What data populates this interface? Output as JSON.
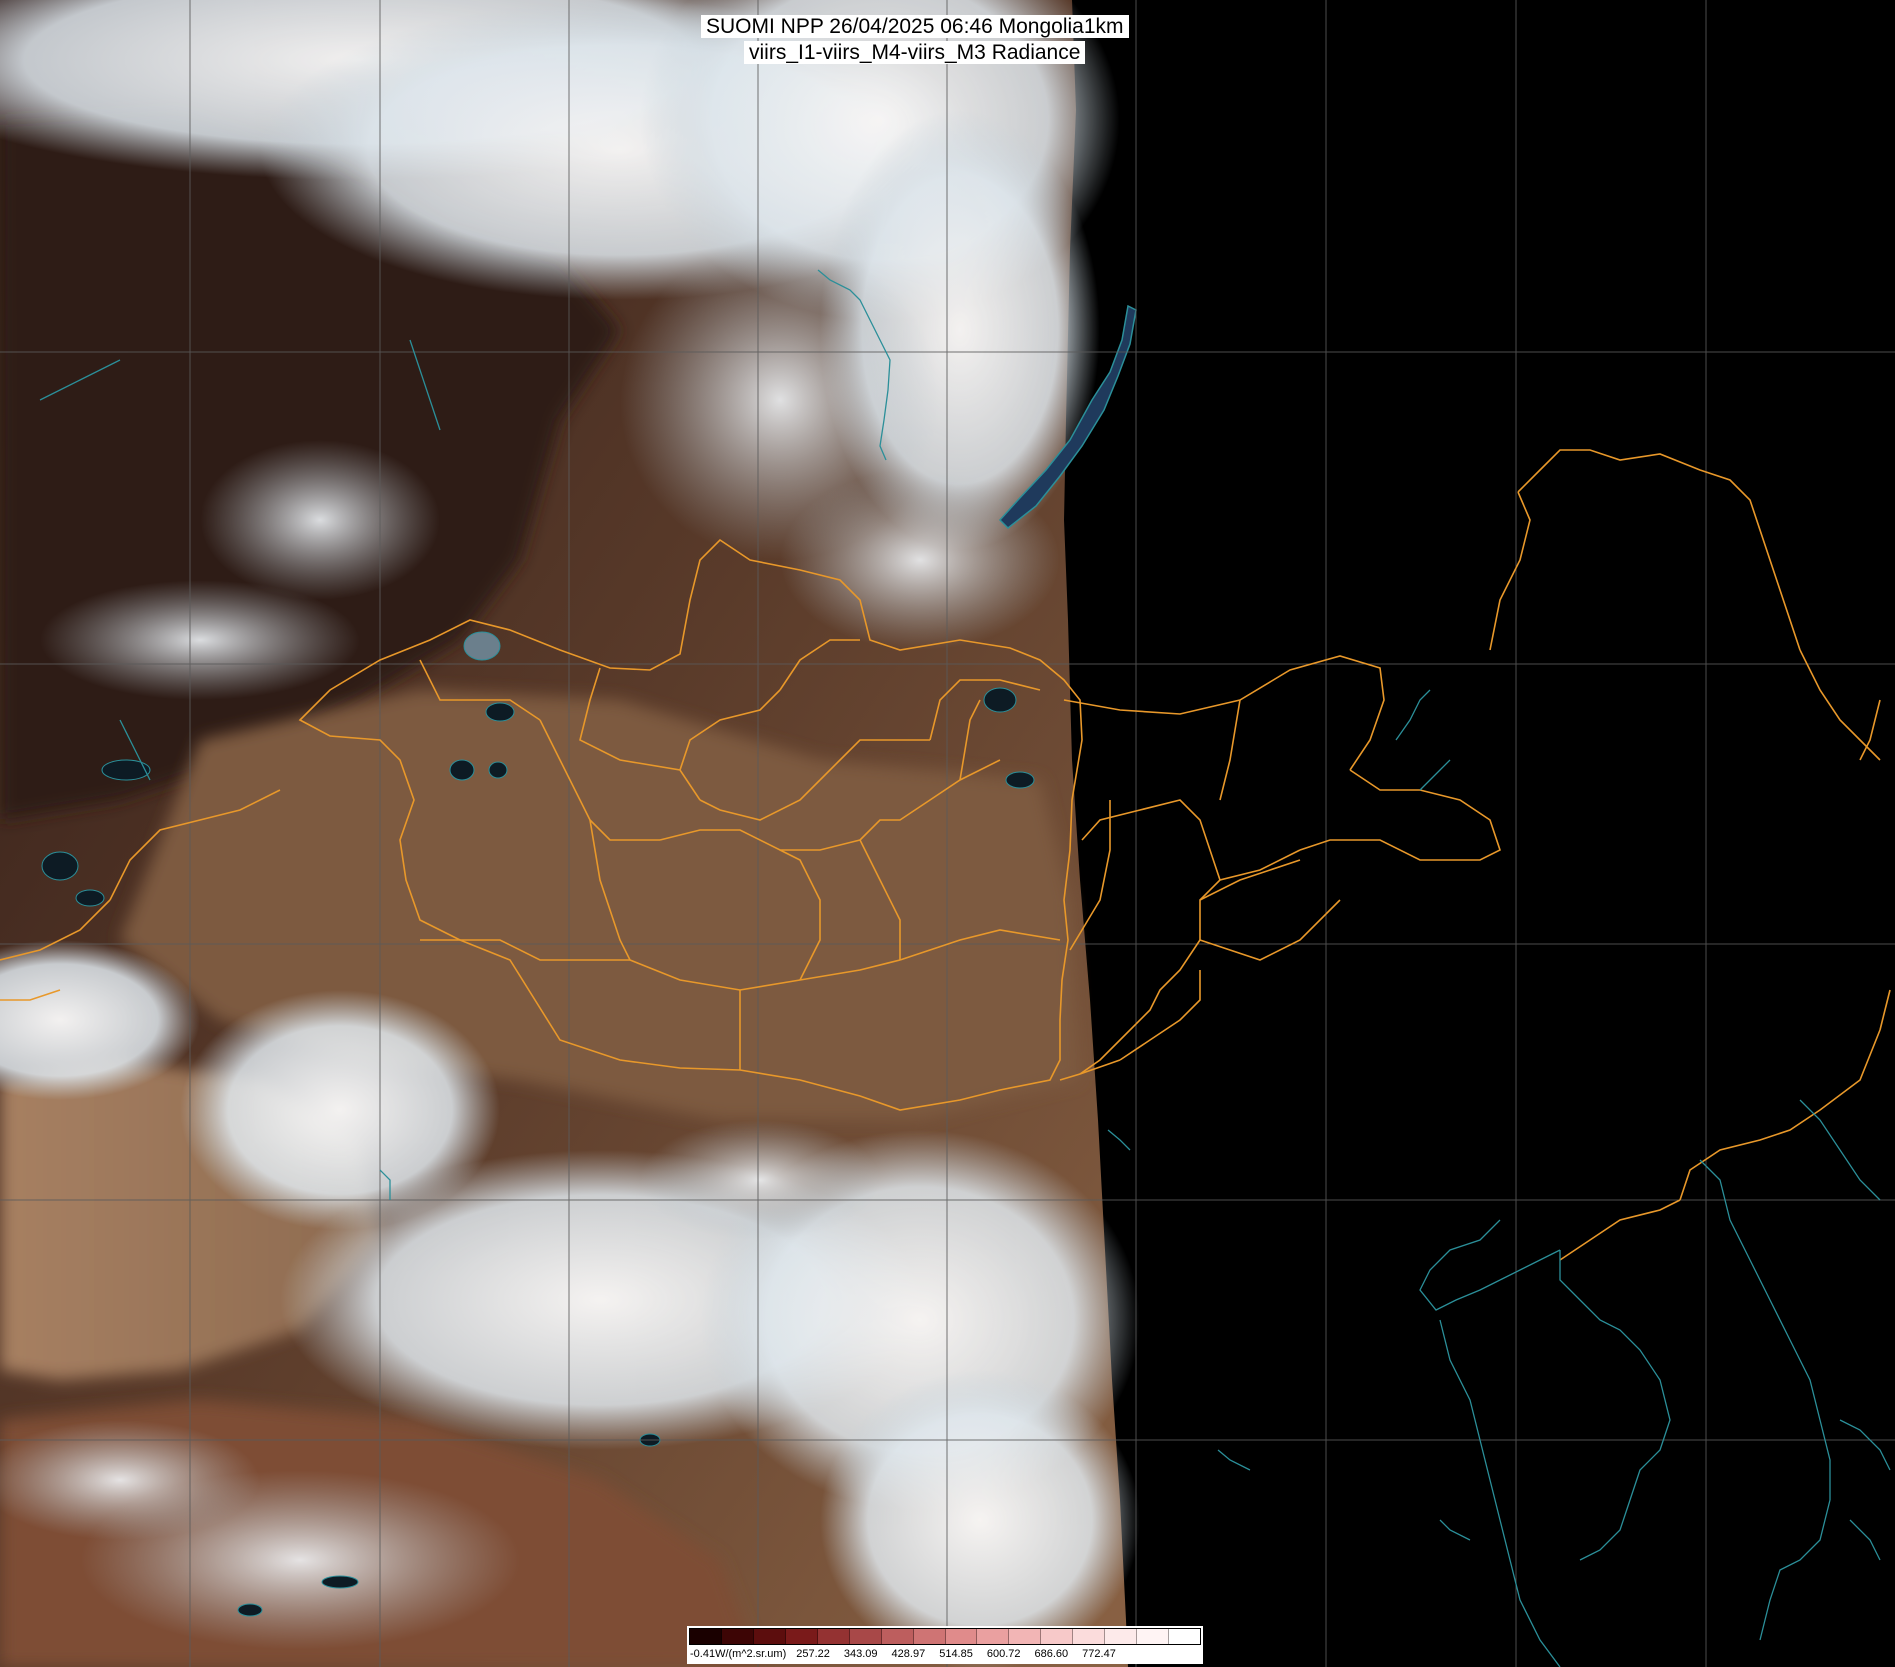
{
  "title": {
    "line1": "SUOMI NPP 26/04/2025 06:46 Mongolia1km",
    "line2": "viirs_I1-viirs_M4-viirs_M3 Radiance"
  },
  "colorbar": {
    "unit_label": "-0.41W/(m^2.sr.um)",
    "tick_labels": [
      "257.22",
      "343.09",
      "428.97",
      "514.85",
      "600.72",
      "686.60",
      "772.47"
    ],
    "colors": [
      "#1a0000",
      "#3d0505",
      "#5c0d0d",
      "#7a1a1a",
      "#943232",
      "#a84848",
      "#bd5e5e",
      "#cf7474",
      "#e08b8b",
      "#eaa0a0",
      "#f2b5b5",
      "#f7c9c9",
      "#fbdcdc",
      "#fdeaea",
      "#fff4f4",
      "#ffffff"
    ]
  },
  "map": {
    "colors": {
      "background": "#000000",
      "gridline": "#5a5a5a",
      "border": "#e8982a",
      "coastline": "#2b8f99",
      "cloud": "#e9f2f7",
      "terrain_dark": "#3a2420",
      "terrain_brown": "#7a5538",
      "desert": "#b08763"
    },
    "overlays": [
      "political-borders",
      "coastlines",
      "lat-lon-grid"
    ]
  }
}
